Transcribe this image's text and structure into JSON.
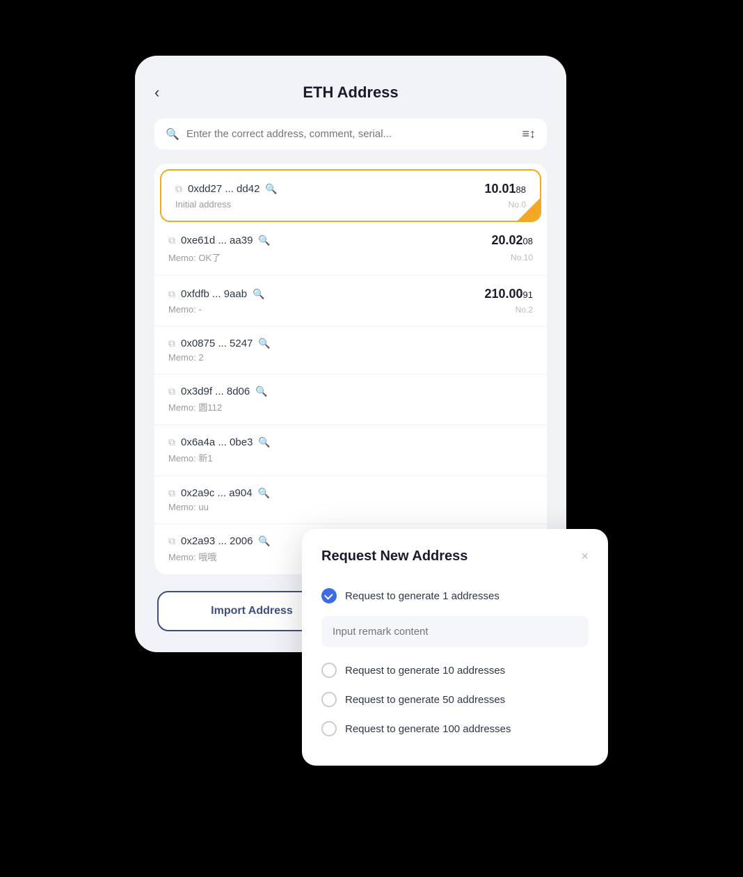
{
  "header": {
    "title": "ETH Address",
    "back_label": "‹"
  },
  "search": {
    "placeholder": "Enter the correct address, comment, serial...",
    "filter_icon": "≡↕"
  },
  "addresses": [
    {
      "id": 0,
      "address": "0xdd27 ... dd42",
      "memo": "Initial address",
      "amount_main": "10.01",
      "amount_small": "88",
      "no": "No.0",
      "active": true
    },
    {
      "id": 1,
      "address": "0xe61d ... aa39",
      "memo": "Memo: OK了",
      "amount_main": "20.02",
      "amount_small": "08",
      "no": "No.10",
      "active": false
    },
    {
      "id": 2,
      "address": "0xfdfb ... 9aab",
      "memo": "Memo: -",
      "amount_main": "210.00",
      "amount_small": "91",
      "no": "No.2",
      "active": false
    },
    {
      "id": 3,
      "address": "0x0875 ... 5247",
      "memo": "Memo: 2",
      "amount_main": "",
      "amount_small": "",
      "no": "",
      "active": false
    },
    {
      "id": 4,
      "address": "0x3d9f ... 8d06",
      "memo": "Memo: 圆112",
      "amount_main": "",
      "amount_small": "",
      "no": "",
      "active": false
    },
    {
      "id": 5,
      "address": "0x6a4a ... 0be3",
      "memo": "Memo: 新1",
      "amount_main": "",
      "amount_small": "",
      "no": "",
      "active": false
    },
    {
      "id": 6,
      "address": "0x2a9c ... a904",
      "memo": "Memo: uu",
      "amount_main": "",
      "amount_small": "",
      "no": "",
      "active": false
    },
    {
      "id": 7,
      "address": "0x2a93 ... 2006",
      "memo": "Memo: 哦哦",
      "amount_main": "",
      "amount_small": "",
      "no": "",
      "active": false
    }
  ],
  "buttons": {
    "import": "Import Address",
    "request": "Request New Address"
  },
  "modal": {
    "title": "Request New Address",
    "close_icon": "×",
    "options": [
      {
        "label": "Request to generate 1 addresses",
        "selected": true
      },
      {
        "label": "Request to generate 10 addresses",
        "selected": false
      },
      {
        "label": "Request to generate 50 addresses",
        "selected": false
      },
      {
        "label": "Request to generate 100 addresses",
        "selected": false
      }
    ],
    "remark_placeholder": "Input remark content"
  }
}
